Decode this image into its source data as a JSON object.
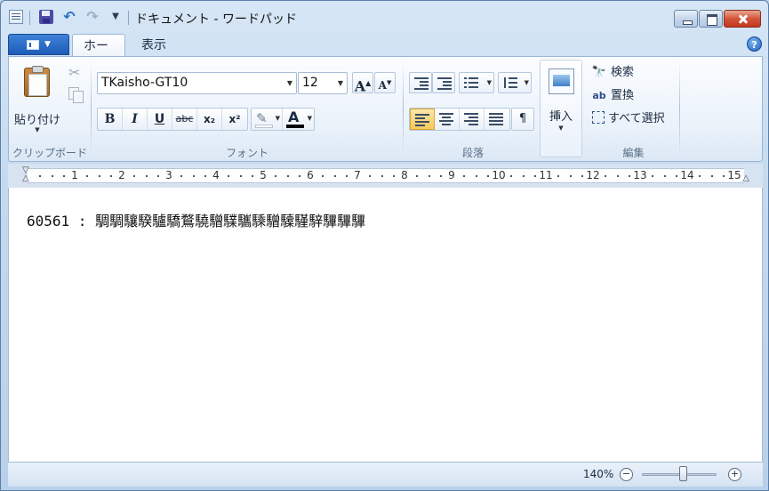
{
  "window": {
    "title": "ドキュメント - ワードパッド"
  },
  "quick_access": {
    "save_icon": "save-icon",
    "undo_icon": "undo-icon",
    "redo_icon": "redo-icon",
    "customize_icon": "chevron-down-icon"
  },
  "tabs": [
    {
      "label": "ホーム",
      "active": true
    },
    {
      "label": "表示",
      "active": false
    }
  ],
  "ribbon": {
    "clipboard": {
      "label": "クリップボード",
      "paste_label": "貼り付け"
    },
    "font": {
      "label": "フォント",
      "font_name": "TKaisho-GT10",
      "font_size": "12",
      "grow_glyph": "A",
      "shrink_glyph": "A",
      "bold_glyph": "B",
      "italic_glyph": "I",
      "underline_glyph": "U",
      "strike_glyph": "abc",
      "subscript_glyph": "x₂",
      "superscript_glyph": "x²",
      "font_color_glyph": "A"
    },
    "paragraph": {
      "label": "段落",
      "active_alignment": "left"
    },
    "insert": {
      "label": "挿入"
    },
    "editing": {
      "label": "編集",
      "find_label": "検索",
      "replace_label": "置換",
      "select_all_label": "すべて選択"
    }
  },
  "ruler": {
    "numbers": [
      "1",
      "2",
      "3",
      "4",
      "5",
      "6",
      "7",
      "8",
      "9",
      "10",
      "11",
      "12",
      "13",
      "14",
      "15"
    ]
  },
  "document": {
    "text": "60561 : 騆騆驤騤驢驕鶩驍驓驜驨騬驓驝騹騂驆驆驆"
  },
  "status": {
    "zoom_label": "140%",
    "zoom_fraction": 0.55
  }
}
